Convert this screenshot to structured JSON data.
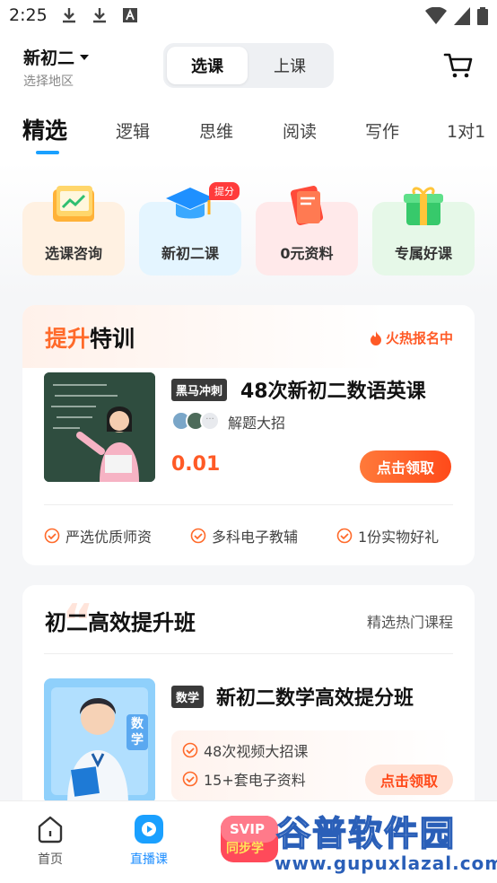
{
  "status_bar": {
    "time": "2:25",
    "icons_left": [
      "download-icon",
      "download-icon",
      "a-notification-icon"
    ],
    "icons_right": [
      "wifi-icon",
      "cellular-icon",
      "battery-icon"
    ]
  },
  "header": {
    "grade": "新初二",
    "region_label": "选择地区",
    "segments": [
      "选课",
      "上课"
    ],
    "active_segment": "选课",
    "cart_icon": "cart-icon"
  },
  "tabs": {
    "items": [
      "精选",
      "逻辑",
      "思维",
      "阅读",
      "写作",
      "1对1"
    ],
    "active": "精选",
    "accent": "#1aa0ff"
  },
  "quick_entries": [
    {
      "label": "选课咨询",
      "icon": "folder-chart-icon",
      "bg": "#fff1e2"
    },
    {
      "label": "新初二课",
      "icon": "graduation-cap-icon",
      "bg": "#e4f5ff",
      "badge": "提分"
    },
    {
      "label": "0元资料",
      "icon": "book-icon",
      "bg": "#ffe9ea"
    },
    {
      "label": "专属好课",
      "icon": "gift-icon",
      "bg": "#e6f8e8"
    }
  ],
  "promo_card": {
    "title_highlight": "提升",
    "title_rest": "特训",
    "hot_label": "火热报名中",
    "course_badge": "黑马冲刺",
    "course_title": "48次新初二数语英课",
    "subtitle": "解题大招",
    "price": "0.01",
    "button": "点击领取",
    "features": [
      "严选优质师资",
      "多科电子教辅",
      "1份实物好礼"
    ]
  },
  "class_card": {
    "title": "初二高效提升班",
    "more_label": "精选热门课程",
    "course_badge": "数学",
    "course_title": "新初二数学高效提分班",
    "thumb_subject": "数学",
    "features": [
      "48次视频大招课",
      "15+套电子资料"
    ],
    "button": "点击领取"
  },
  "bottom_nav": {
    "items": [
      {
        "label": "首页",
        "icon": "home-icon",
        "active": false
      },
      {
        "label": "直播课",
        "icon": "live-play-icon",
        "active": true
      }
    ],
    "center_badge": "SVIP",
    "center_badge_sub": "同步学"
  },
  "watermark": {
    "top": "谷普软件园",
    "bottom": "www.gupuxlazal.com"
  },
  "colors": {
    "accent_blue": "#1aa0ff",
    "accent_orange": "#ff5a26"
  }
}
